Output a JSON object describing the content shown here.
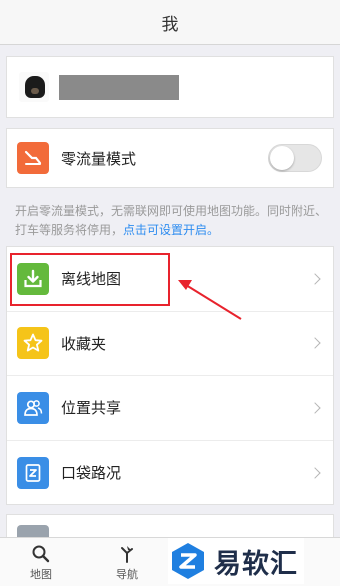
{
  "header": {
    "title": "我"
  },
  "profile": {
    "avatar_icon": "dog-avatar",
    "name_redacted": true
  },
  "zero_traffic": {
    "label": "零流量模式",
    "icon": "zero-traffic-icon",
    "enabled": false
  },
  "hint": {
    "text": "开启零流量模式，无需联网即可使用地图功能。同时附近、打车等服务将停用，",
    "link": "点击可设置开启。"
  },
  "menu": {
    "items": [
      {
        "label": "离线地图",
        "icon": "download-icon",
        "color": "#64b93c"
      },
      {
        "label": "收藏夹",
        "icon": "star-icon",
        "color": "#f5c419"
      },
      {
        "label": "位置共享",
        "icon": "users-icon",
        "color": "#3a8ee6"
      },
      {
        "label": "口袋路况",
        "icon": "traffic-icon",
        "color": "#3a8ee6"
      }
    ]
  },
  "tabs": [
    {
      "label": "地图",
      "icon": "search-icon"
    },
    {
      "label": "导航",
      "icon": "navigation-icon"
    }
  ],
  "annotation": {
    "highlight_color": "#e8232d"
  },
  "watermark": {
    "text": "易软汇"
  }
}
